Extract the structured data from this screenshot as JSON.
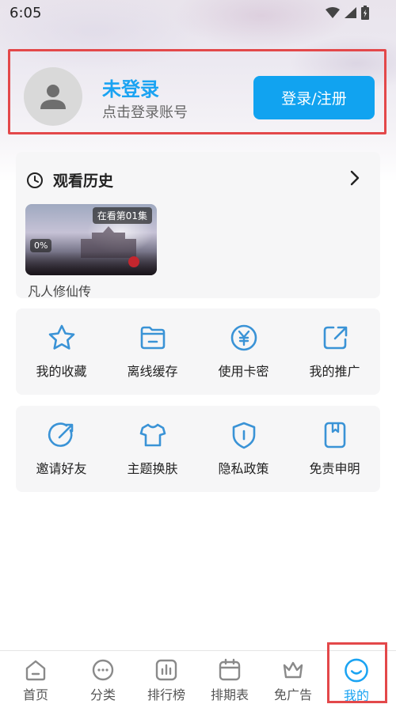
{
  "status": {
    "time": "6:05"
  },
  "profile": {
    "title": "未登录",
    "subtitle": "点击登录账号",
    "login_button": "登录/注册"
  },
  "history": {
    "title": "观看历史",
    "item": {
      "episode_badge": "在看第01集",
      "progress": "0%",
      "name": "凡人修仙传"
    }
  },
  "grid1": [
    {
      "label": "我的收藏",
      "icon": "star-icon"
    },
    {
      "label": "离线缓存",
      "icon": "folder-icon"
    },
    {
      "label": "使用卡密",
      "icon": "yen-icon"
    },
    {
      "label": "我的推广",
      "icon": "share-icon"
    }
  ],
  "grid2": [
    {
      "label": "邀请好友",
      "icon": "invite-icon"
    },
    {
      "label": "主题换肤",
      "icon": "shirt-icon"
    },
    {
      "label": "隐私政策",
      "icon": "shield-icon"
    },
    {
      "label": "免责申明",
      "icon": "bookmark-icon"
    }
  ],
  "nav": [
    {
      "label": "首页",
      "icon": "home-icon"
    },
    {
      "label": "分类",
      "icon": "category-icon"
    },
    {
      "label": "排行榜",
      "icon": "ranking-icon"
    },
    {
      "label": "排期表",
      "icon": "calendar-icon"
    },
    {
      "label": "免广告",
      "icon": "crown-icon"
    },
    {
      "label": "我的",
      "icon": "smile-icon",
      "active": true
    }
  ],
  "colors": {
    "accent": "#1aa3f2",
    "highlight": "#e3484a"
  }
}
